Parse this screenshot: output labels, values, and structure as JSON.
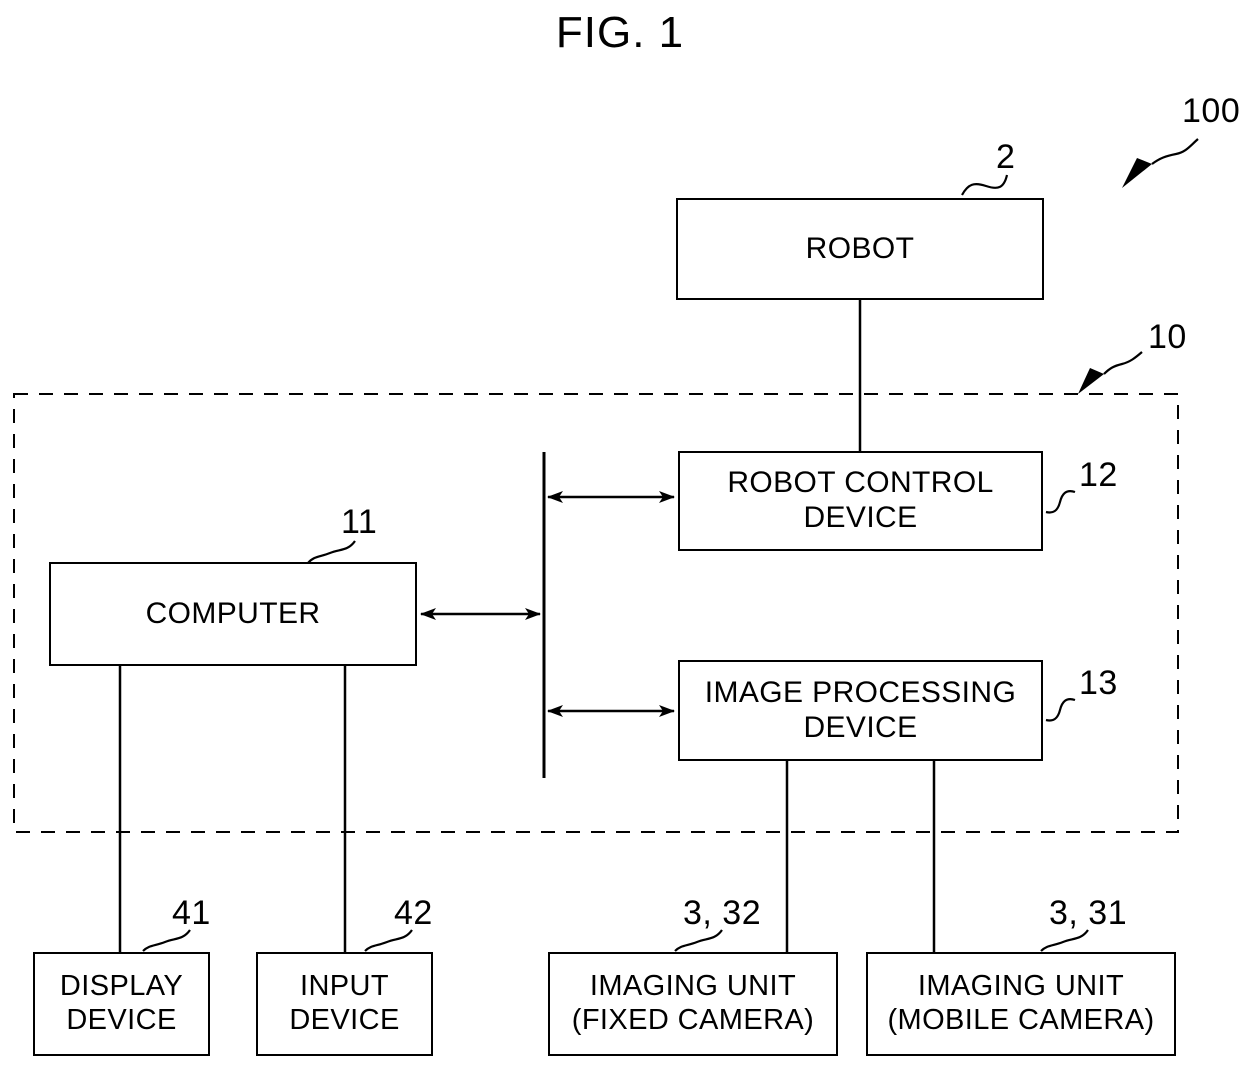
{
  "figure": {
    "title": "FIG. 1",
    "system_ref": "100",
    "ink_color": "#000000",
    "background_color": "#ffffff"
  },
  "boundary": {
    "label": "10",
    "style": "dashed",
    "name": "control-system-boundary"
  },
  "nodes": [
    {
      "id": "robot",
      "label": "ROBOT",
      "ref": "2"
    },
    {
      "id": "robot-control",
      "label": "ROBOT CONTROL\nDEVICE",
      "ref": "12"
    },
    {
      "id": "image-proc",
      "label": "IMAGE PROCESSING\nDEVICE",
      "ref": "13"
    },
    {
      "id": "computer",
      "label": "COMPUTER",
      "ref": "11"
    },
    {
      "id": "display",
      "label": "DISPLAY\nDEVICE",
      "ref": "41"
    },
    {
      "id": "input",
      "label": "INPUT\nDEVICE",
      "ref": "42"
    },
    {
      "id": "imaging-fixed",
      "label": "IMAGING UNIT\n(FIXED CAMERA)",
      "ref": "3, 32"
    },
    {
      "id": "imaging-mobile",
      "label": "IMAGING UNIT\n(MOBILE CAMERA)",
      "ref": "3, 31"
    }
  ],
  "connections": [
    {
      "from": "robot",
      "to": "robot-control",
      "arrows": "none"
    },
    {
      "from": "computer",
      "to": "bus",
      "arrows": "both"
    },
    {
      "from": "bus",
      "to": "robot-control",
      "arrows": "both"
    },
    {
      "from": "bus",
      "to": "image-proc",
      "arrows": "both"
    },
    {
      "from": "computer",
      "to": "display",
      "arrows": "none"
    },
    {
      "from": "computer",
      "to": "input",
      "arrows": "none"
    },
    {
      "from": "image-proc",
      "to": "imaging-fixed",
      "arrows": "none"
    },
    {
      "from": "image-proc",
      "to": "imaging-mobile",
      "arrows": "none"
    }
  ]
}
